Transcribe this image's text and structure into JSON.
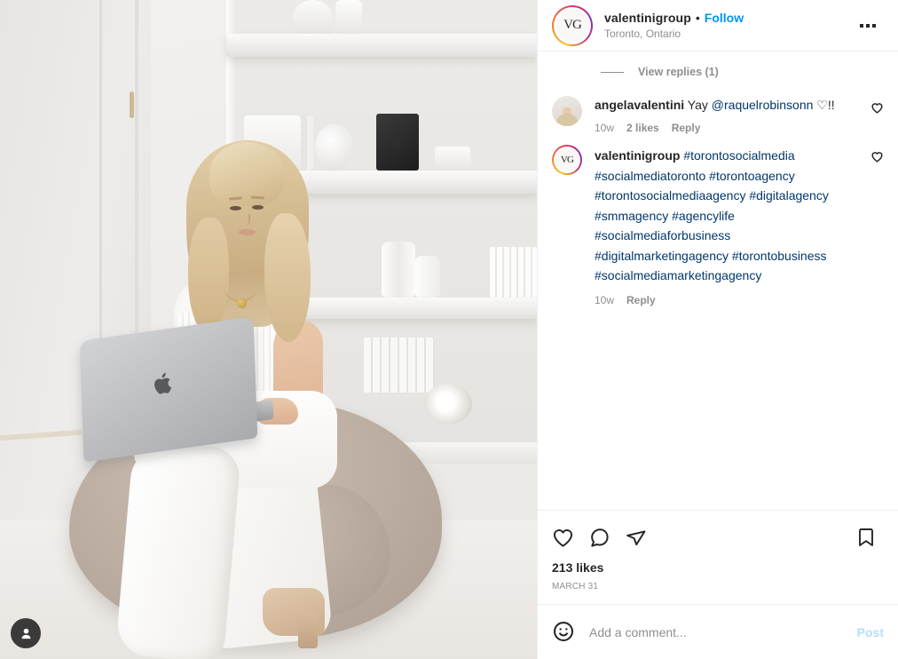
{
  "header": {
    "avatar_initials": "VG",
    "username": "valentinigroup",
    "separator": "•",
    "follow_label": "Follow",
    "location": "Toronto, Ontario",
    "more_icon": "more-options-icon"
  },
  "comments_section": {
    "view_replies_label": "View replies (1)",
    "items": [
      {
        "avatar_type": "photo",
        "username": "angelavalentini",
        "text": " Yay ",
        "mention": "@raquelrobinsonn",
        "trailing": " ♡!!",
        "time": "10w",
        "likes": "2 likes",
        "reply_label": "Reply",
        "like_icon": "heart-icon"
      },
      {
        "avatar_type": "ring",
        "avatar_initials": "VG",
        "username": "valentinigroup",
        "hashtags": " #torontosocialmedia #socialmediatoronto #torontoagency #torontosocialmediaagency #digitalagency #smmagency #agencylife #socialmediaforbusiness #digitalmarketingagency #torontobusiness #socialmediamarketingagency",
        "time": "10w",
        "reply_label": "Reply",
        "like_icon": "heart-icon"
      }
    ]
  },
  "actions": {
    "like_icon": "heart-icon",
    "comment_icon": "comment-bubble-icon",
    "share_icon": "share-paper-plane-icon",
    "save_icon": "bookmark-icon",
    "likes_count": "213 likes",
    "post_date": "MARCH 31"
  },
  "add_comment": {
    "emoji_icon": "emoji-smiley-icon",
    "placeholder": "Add a comment...",
    "post_label": "Post",
    "value": ""
  },
  "media": {
    "tag_icon": "person-tag-icon",
    "alt": "Woman with blonde hair in white top and white pants sitting on a taupe bean bag using a silver MacBook laptop in a bright white room with built-in shelving"
  },
  "colors": {
    "accent_blue": "#0095f6",
    "link_blue": "#00376b",
    "post_disabled": "#b2dffc",
    "text_primary": "#262626",
    "text_secondary": "#8e8e8e",
    "border": "#efefef"
  }
}
